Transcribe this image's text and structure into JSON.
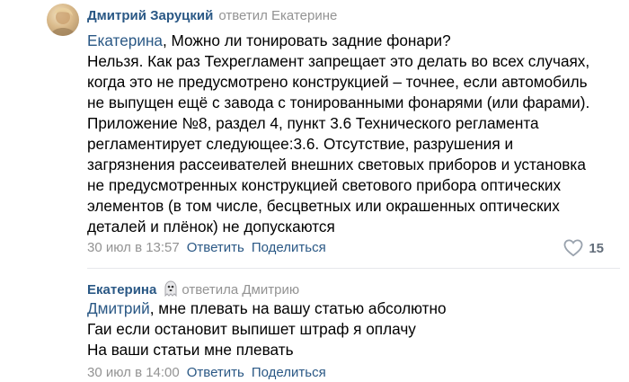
{
  "comment1": {
    "author": "Дмитрий Заруцкий",
    "replied_to": "ответил Екатерине",
    "mention": "Екатерина",
    "first_line_rest": ", Можно ли тонировать задние фонари?",
    "lines": [
      "Нельзя. Как раз Техрегламент запрещает это делать во всех случаях,",
      "когда это не предусмотрено конструкцией – точнее, если автомобиль",
      "не выпущен ещё с завода с тонированными фонарями (или фарами).",
      "Приложение №8, раздел 4, пункт 3.6 Технического регламента",
      "регламентирует следующее:3.6. Отсутствие, разрушения и",
      "загрязнения рассеивателей внешних световых приборов и установка",
      "не предусмотренных конструкцией светового прибора оптических",
      "элементов (в том числе, бесцветных или окрашенных оптических",
      "деталей и плёнок) не допускаются"
    ],
    "date": "30 июл в 13:57",
    "reply_label": "Ответить",
    "share_label": "Поделиться",
    "likes_count": "15"
  },
  "comment2": {
    "author": "Екатерина",
    "replied_to": "ответила Дмитрию",
    "mention": "Дмитрий",
    "first_line_rest": ", мне плевать на вашу статью абсолютно",
    "lines": [
      "Гаи если остановит выпишет штраф я оплачу",
      "На ваши статьи мне плевать"
    ],
    "date": "30 июл в 14:00",
    "reply_label": "Ответить",
    "share_label": "Поделиться"
  },
  "colors": {
    "link": "#2a5885",
    "muted": "#939393",
    "divider": "#e7e8ec"
  }
}
